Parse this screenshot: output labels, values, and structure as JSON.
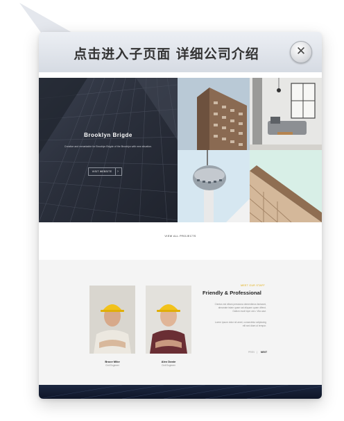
{
  "popup": {
    "title": "点击进入子页面 详细公司介绍",
    "close_icon": "close-icon"
  },
  "hero": {
    "title": "Brooklyn Brigde",
    "description": "Creative and remarkable for Brooklyn Brigde of the Brooklyn with new situation.",
    "button_label": "VISIT WEBSITE",
    "arrow_icon": "arrow-right-icon"
  },
  "projects": {
    "view_all_label": "VIEW ALL PROJECTS",
    "tiles": [
      "flatiron-building-photo",
      "living-room-interior-photo",
      "tv-tower-photo",
      "building-facade-photo"
    ]
  },
  "team": {
    "eyebrow": "MEET OUR STAFF",
    "title": "Friendly & Professional",
    "paragraph1": "Cientos est viltam pressiona dementimos fantasmi, almanate istam quam sat aliquam quam diferoi. Gallom modt inpe cero. Vita caut.",
    "paragraph2": "Lorem ipsum dolor sit amet, consectetur adipiscing elit sed diam ut tempor.",
    "prev_label": "PREV",
    "separator": "|",
    "next_label": "NEXT",
    "members": [
      {
        "name": "Bruce Mike",
        "role": "Civil Engineer"
      },
      {
        "name": "Alex Doste",
        "role": "Civil Engineer"
      }
    ]
  },
  "colors": {
    "accent": "#e0a800",
    "header_top": "#eceff4",
    "header_bottom": "#d6dbe3",
    "hero_bg": "#2a2f3b",
    "footer": "#1c2740"
  }
}
